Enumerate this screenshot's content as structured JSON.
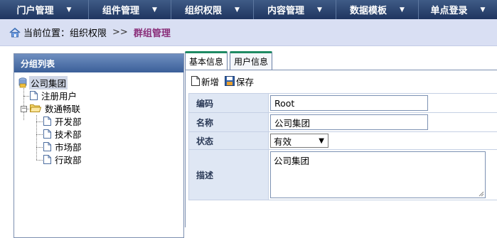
{
  "nav": {
    "items": [
      {
        "label": "门户管理"
      },
      {
        "label": "组件管理"
      },
      {
        "label": "组织权限"
      },
      {
        "label": "内容管理"
      },
      {
        "label": "数据模板"
      },
      {
        "label": "单点登录"
      }
    ]
  },
  "breadcrumb": {
    "prefix": "当前位置：",
    "parent": "组织权限",
    "separator": ">>",
    "current": "群组管理"
  },
  "left_panel": {
    "title": "分组列表",
    "tree": {
      "root": "公司集团",
      "registered_users": "注册用户",
      "group": "数通畅联",
      "children": [
        "开发部",
        "技术部",
        "市场部",
        "行政部"
      ]
    }
  },
  "tabs": [
    {
      "label": "基本信息"
    },
    {
      "label": "用户信息"
    }
  ],
  "toolbar": {
    "new_label": "新增",
    "save_label": "保存"
  },
  "form": {
    "code_label": "编码",
    "code_value": "Root",
    "name_label": "名称",
    "name_value": "公司集团",
    "status_label": "状态",
    "status_value": "有效",
    "desc_label": "描述",
    "desc_value": "公司集团"
  }
}
